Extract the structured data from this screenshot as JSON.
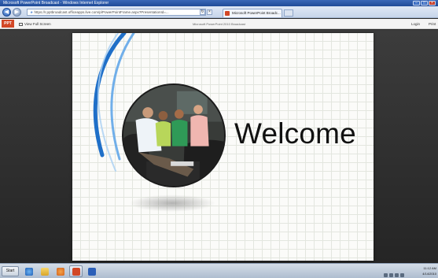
{
  "window": {
    "title": "Microsoft PowerPoint Broadcast - Windows Internet Explorer",
    "minimize": "–",
    "maximize": "□",
    "close": "×"
  },
  "browser": {
    "back": "◀",
    "forward": "▶",
    "address": "https://r.pptbroadcast.officeapps.live.com/p/PowerPointFrame.aspx?PresentationId=...",
    "refresh": "↻",
    "stop": "×",
    "tab_title": "Microsoft PowerPoint Broadc...",
    "tab_close": "×"
  },
  "app": {
    "logo": "PPT",
    "full_screen": "View Full Screen",
    "broadcast_title": "Microsoft PowerPoint 2010 Broadcast",
    "login": "Login",
    "print": "Print"
  },
  "slide": {
    "title": "Welcome"
  },
  "taskbar": {
    "start": "Start",
    "clock_time": "11:12 AM",
    "clock_date": "4/14/2010"
  },
  "colors": {
    "accent": "#d24726",
    "swoosh": "#2a7fd6",
    "stage": "#2b2b2b"
  }
}
